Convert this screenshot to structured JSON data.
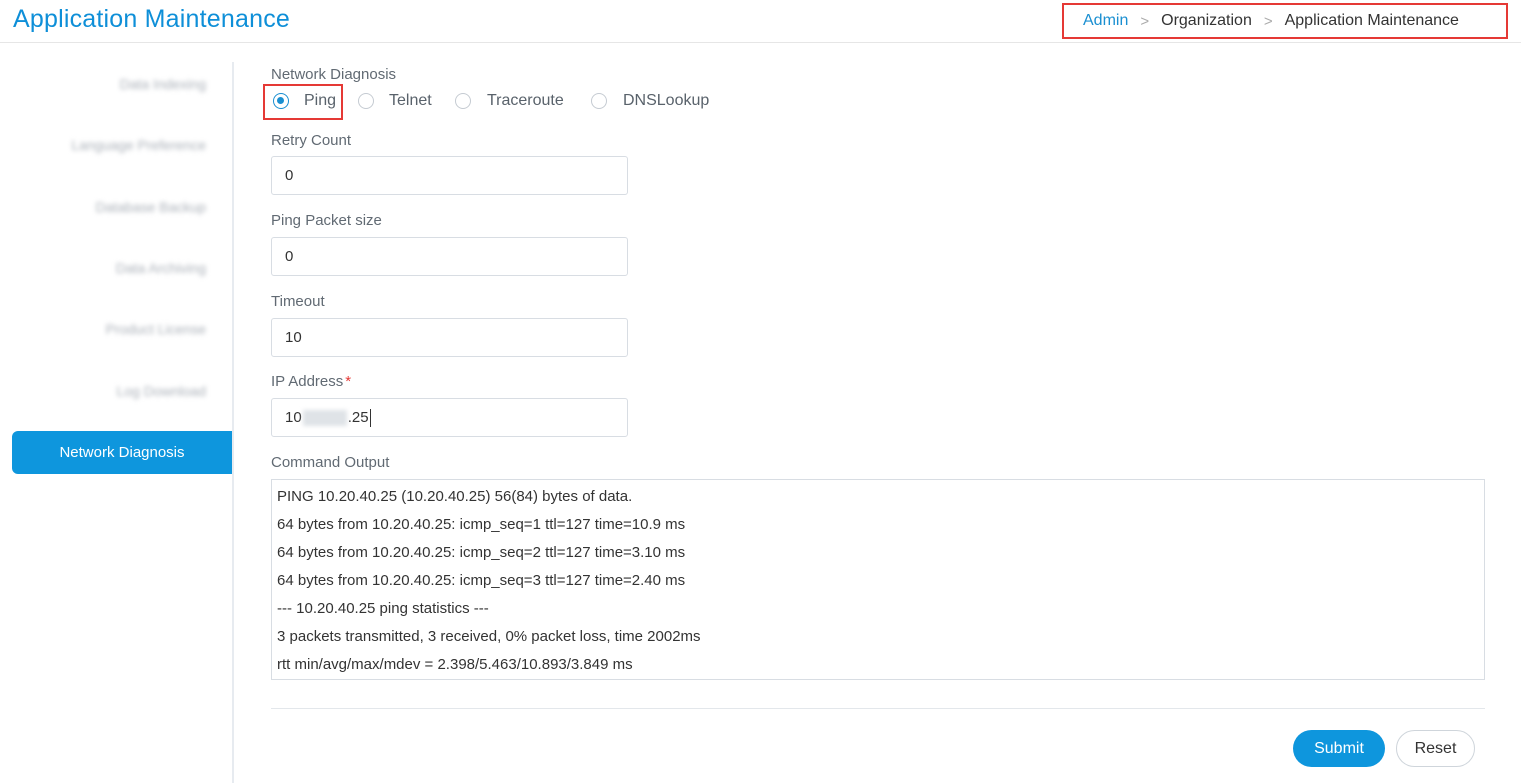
{
  "header": {
    "title": "Application Maintenance",
    "breadcrumb": [
      "Admin",
      "Organization",
      "Application Maintenance"
    ],
    "separator": ">"
  },
  "sidebar": {
    "items": [
      {
        "label": "Data Indexing"
      },
      {
        "label": "Language Preference"
      },
      {
        "label": "Database Backup"
      },
      {
        "label": "Data Archiving"
      },
      {
        "label": "Product License"
      },
      {
        "label": "Log Download"
      }
    ],
    "active_label": "Network Diagnosis"
  },
  "form": {
    "section_label": "Network Diagnosis",
    "radios": [
      {
        "label": "Ping",
        "checked": true
      },
      {
        "label": "Telnet",
        "checked": false
      },
      {
        "label": "Traceroute",
        "checked": false
      },
      {
        "label": "DNSLookup",
        "checked": false
      }
    ],
    "retry_count": {
      "label": "Retry Count",
      "value": "0"
    },
    "ping_packet_size": {
      "label": "Ping Packet size",
      "value": "0"
    },
    "timeout": {
      "label": "Timeout",
      "value": "10"
    },
    "ip_address": {
      "label": "IP Address",
      "required_mark": "*",
      "value_prefix": "10",
      "value_suffix": ".25"
    },
    "command_output": {
      "label": "Command Output",
      "lines": [
        "PING 10.20.40.25 (10.20.40.25) 56(84) bytes of data.",
        "64 bytes from 10.20.40.25: icmp_seq=1 ttl=127 time=10.9 ms",
        "64 bytes from 10.20.40.25: icmp_seq=2 ttl=127 time=3.10 ms",
        "64 bytes from 10.20.40.25: icmp_seq=3 ttl=127 time=2.40 ms",
        "--- 10.20.40.25 ping statistics ---",
        "3 packets transmitted, 3 received, 0% packet loss, time 2002ms",
        "rtt min/avg/max/mdev = 2.398/5.463/10.893/3.849 ms"
      ]
    }
  },
  "actions": {
    "submit_label": "Submit",
    "reset_label": "Reset"
  },
  "colors": {
    "accent": "#0e96dd",
    "highlight_border": "#e53935"
  }
}
